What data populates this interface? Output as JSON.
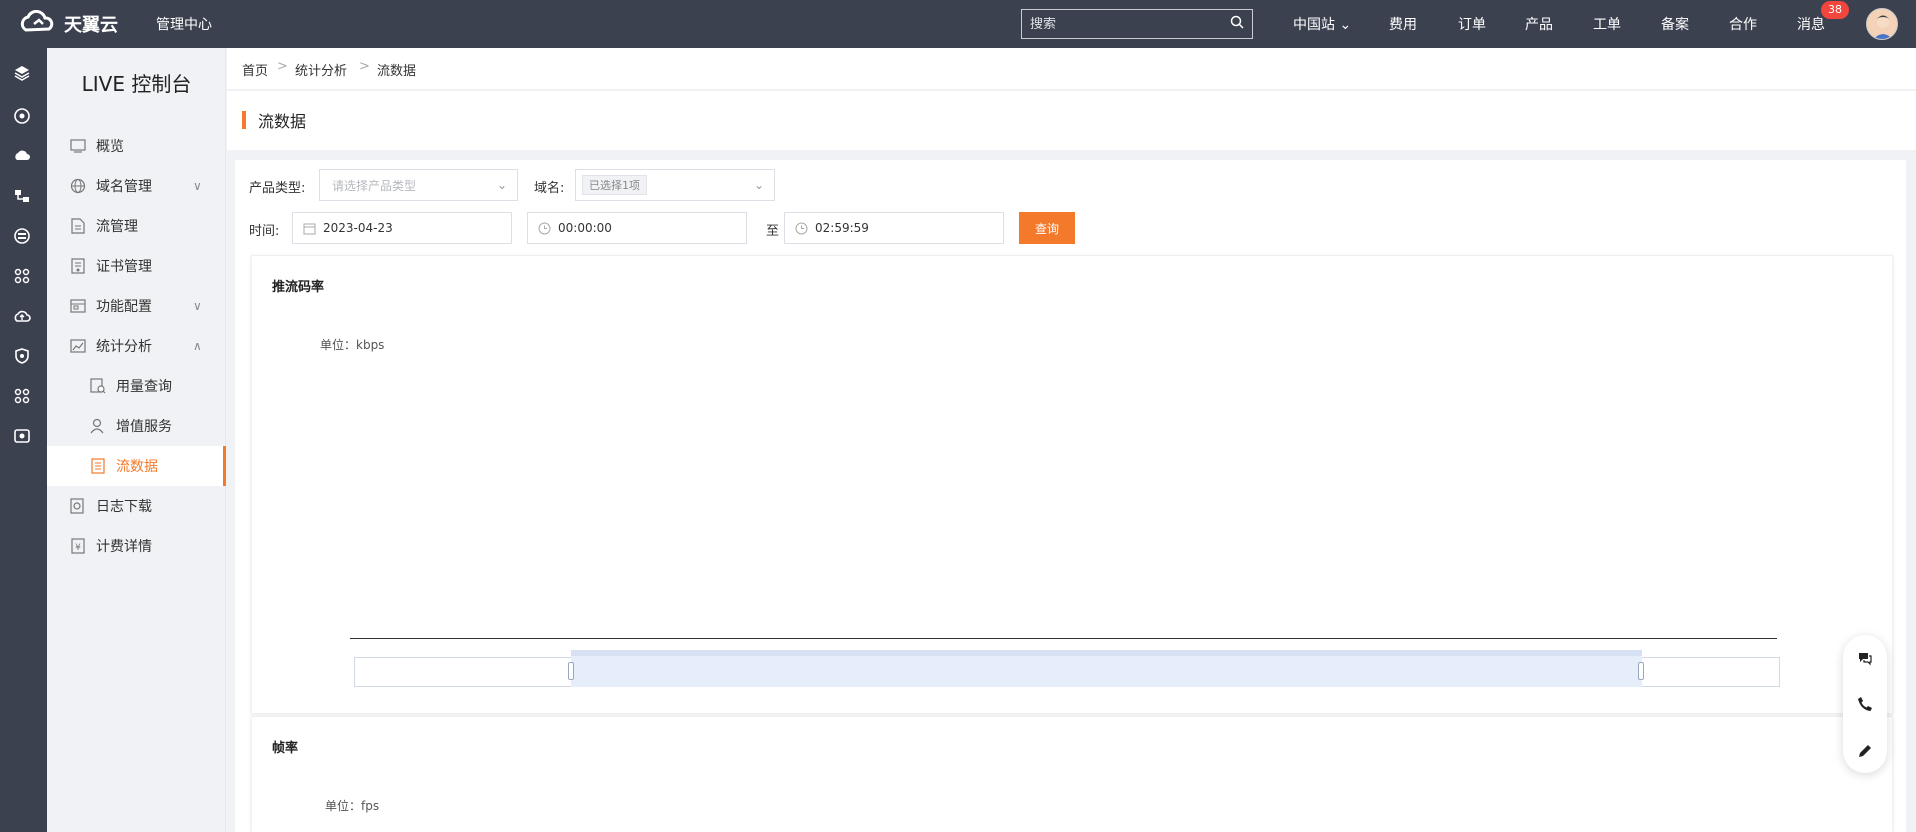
{
  "header": {
    "logo_text": "天翼云",
    "mgmt_center": "管理中心",
    "search_placeholder": "搜索",
    "nav": {
      "region": "中国站",
      "fees": "费用",
      "orders": "订单",
      "products": "产品",
      "tickets": "工单",
      "filing": "备案",
      "cooperation": "合作",
      "messages": "消息"
    },
    "message_count": "38"
  },
  "sidebar": {
    "title": "LIVE 控制台",
    "items": [
      {
        "label": "概览",
        "icon": "monitor-icon"
      },
      {
        "label": "域名管理",
        "icon": "globe-icon",
        "expand": "∨"
      },
      {
        "label": "流管理",
        "icon": "document-icon"
      },
      {
        "label": "证书管理",
        "icon": "certificate-icon"
      },
      {
        "label": "功能配置",
        "icon": "settings-panel-icon",
        "expand": "∨"
      },
      {
        "label": "统计分析",
        "icon": "chart-icon",
        "expand": "∧"
      },
      {
        "label": "用量查询",
        "icon": "usage-icon"
      },
      {
        "label": "增值服务",
        "icon": "user-icon"
      },
      {
        "label": "流数据",
        "icon": "stream-data-icon"
      },
      {
        "label": "日志下载",
        "icon": "log-icon"
      },
      {
        "label": "计费详情",
        "icon": "billing-icon"
      }
    ]
  },
  "breadcrumb": {
    "home": "首页",
    "section": "统计分析",
    "current": "流数据",
    "sep": ">"
  },
  "page": {
    "title": "流数据"
  },
  "filters": {
    "product_type_label": "产品类型:",
    "product_type_placeholder": "请选择产品类型",
    "domain_label": "域名:",
    "domain_selected": "已选择1项",
    "time_label": "时间:",
    "date": "2023-04-23",
    "start_time": "00:00:00",
    "to_label": "至",
    "end_time": "02:59:59",
    "query_button": "查询"
  },
  "charts": {
    "bitrate_title": "推流码率",
    "bitrate_unit": "单位：kbps",
    "fps_title": "帧率",
    "fps_unit": "单位：fps"
  },
  "colors": {
    "accent": "#f5792a",
    "topbar": "#3c4150",
    "badge": "#f2453d"
  }
}
